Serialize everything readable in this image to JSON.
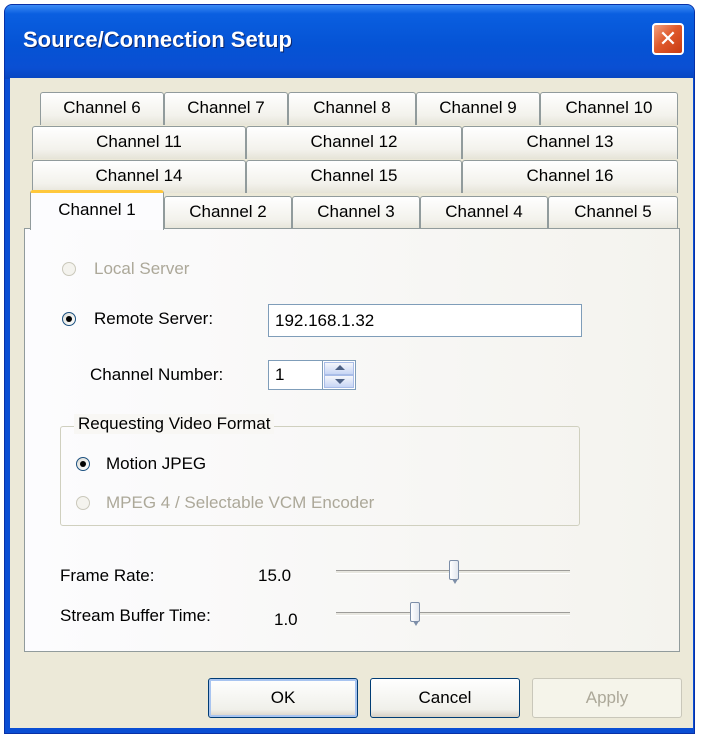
{
  "window": {
    "title": "Source/Connection Setup",
    "close_glyph": "✕"
  },
  "tabs": {
    "row1": [
      "Channel 6",
      "Channel 7",
      "Channel 8",
      "Channel 9",
      "Channel 10"
    ],
    "row2": [
      "Channel 11",
      "Channel 12",
      "Channel 13"
    ],
    "row3": [
      "Channel 14",
      "Channel 15",
      "Channel 16"
    ],
    "row4": [
      "Channel 1",
      "Channel 2",
      "Channel 3",
      "Channel 4",
      "Channel 5"
    ],
    "active": "Channel 1"
  },
  "source": {
    "local_server_label": "Local Server",
    "local_server_selected": false,
    "local_server_enabled": false,
    "remote_server_label": "Remote Server:",
    "remote_server_selected": true,
    "remote_server_value": "192.168.1.32",
    "channel_number_label": "Channel Number:",
    "channel_number_value": "1"
  },
  "video_format": {
    "group_label": "Requesting Video Format",
    "options": [
      {
        "label": "Motion JPEG",
        "selected": true,
        "enabled": true
      },
      {
        "label": "MPEG 4 / Selectable VCM Encoder",
        "selected": false,
        "enabled": false
      }
    ]
  },
  "sliders": {
    "frame_rate": {
      "label": "Frame Rate:",
      "value_text": "15.0",
      "position": 0.5
    },
    "buffer_time": {
      "label": "Stream Buffer Time:",
      "value_text": "1.0",
      "position": 0.33
    }
  },
  "buttons": {
    "ok_label": "OK",
    "cancel_label": "Cancel",
    "apply_label": "Apply",
    "apply_enabled": false
  }
}
